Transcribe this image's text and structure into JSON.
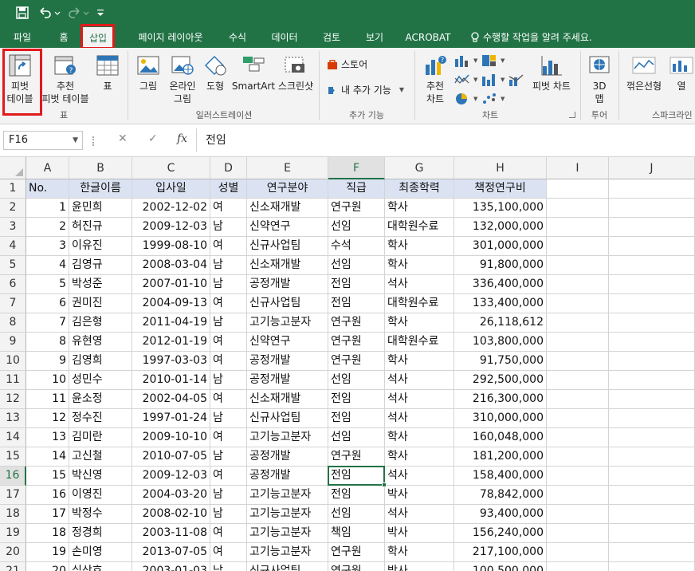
{
  "qat": {
    "save_icon": "save-icon",
    "undo_icon": "undo-icon",
    "redo_icon": "redo-icon",
    "customize_icon": "customize-icon"
  },
  "tabs": [
    "파일",
    "홈",
    "삽입",
    "페이지 레이아웃",
    "수식",
    "데이터",
    "검토",
    "보기",
    "ACROBAT"
  ],
  "tell_me": "수행할 작업을 알려 주세요.",
  "ribbon": {
    "pivot_table": [
      "피벗",
      "테이블"
    ],
    "recommended_pivot": [
      "추천",
      "피벗 테이블"
    ],
    "table": "표",
    "tables_group": "표",
    "picture": "그림",
    "online_picture": [
      "온라인",
      "그림"
    ],
    "shapes": "도형",
    "smartart": "SmartArt",
    "screenshot": "스크린샷",
    "illustrations_group": "일러스트레이션",
    "store": "스토어",
    "my_addins": "내 추가 기능",
    "addins_group": "추가 기능",
    "recommended_charts": [
      "추천",
      "차트"
    ],
    "pivot_chart": "피벗 차트",
    "charts_group": "차트",
    "map3d": [
      "3D",
      "맵"
    ],
    "tours_group": "투어",
    "sparkline_line": "꺾은선형",
    "sparkline_column": "열",
    "sparklines_group": "스파크라인"
  },
  "formula_bar": {
    "name_box": "F16",
    "cancel": "✕",
    "enter": "✓",
    "fx": "fx",
    "content": "전임"
  },
  "columns": [
    "A",
    "B",
    "C",
    "D",
    "E",
    "F",
    "G",
    "H",
    "I",
    "J"
  ],
  "header_row": [
    "No.",
    "한글이름",
    "입사일",
    "성별",
    "연구분야",
    "직급",
    "최종학력",
    "책정연구비"
  ],
  "rows": [
    [
      "1",
      "윤민희",
      "2002-12-02",
      "여",
      "신소재개발",
      "연구원",
      "학사",
      "135,100,000"
    ],
    [
      "2",
      "허진규",
      "2009-12-03",
      "남",
      "신약연구",
      "선임",
      "대학원수료",
      "132,000,000"
    ],
    [
      "3",
      "이유진",
      "1999-08-10",
      "여",
      "신규사업팀",
      "수석",
      "학사",
      "301,000,000"
    ],
    [
      "4",
      "김영규",
      "2008-03-04",
      "남",
      "신소재개발",
      "선임",
      "학사",
      "91,800,000"
    ],
    [
      "5",
      "박성준",
      "2007-01-10",
      "남",
      "공정개발",
      "전임",
      "석사",
      "336,400,000"
    ],
    [
      "6",
      "권미진",
      "2004-09-13",
      "여",
      "신규사업팀",
      "전임",
      "대학원수료",
      "133,400,000"
    ],
    [
      "7",
      "김은형",
      "2011-04-19",
      "남",
      "고기능고분자",
      "연구원",
      "학사",
      "26,118,612"
    ],
    [
      "8",
      "유현영",
      "2012-01-19",
      "여",
      "신약연구",
      "연구원",
      "대학원수료",
      "103,800,000"
    ],
    [
      "9",
      "김영희",
      "1997-03-03",
      "여",
      "공정개발",
      "연구원",
      "학사",
      "91,750,000"
    ],
    [
      "10",
      "성민수",
      "2010-01-14",
      "남",
      "공정개발",
      "선임",
      "석사",
      "292,500,000"
    ],
    [
      "11",
      "윤소정",
      "2002-04-05",
      "여",
      "신소재개발",
      "전임",
      "석사",
      "216,300,000"
    ],
    [
      "12",
      "정수진",
      "1997-01-24",
      "남",
      "신규사업팀",
      "전임",
      "석사",
      "310,000,000"
    ],
    [
      "13",
      "김미란",
      "2009-10-10",
      "여",
      "고기능고분자",
      "선임",
      "학사",
      "160,048,000"
    ],
    [
      "14",
      "고신철",
      "2010-07-05",
      "남",
      "공정개발",
      "연구원",
      "학사",
      "181,200,000"
    ],
    [
      "15",
      "박신영",
      "2009-12-03",
      "여",
      "공정개발",
      "전임",
      "석사",
      "158,400,000"
    ],
    [
      "16",
      "이영진",
      "2004-03-20",
      "남",
      "고기능고분자",
      "전임",
      "박사",
      "78,842,000"
    ],
    [
      "17",
      "박정수",
      "2008-02-10",
      "남",
      "고기능고분자",
      "선임",
      "석사",
      "93,400,000"
    ],
    [
      "18",
      "정경희",
      "2003-11-08",
      "여",
      "고기능고분자",
      "책임",
      "박사",
      "156,240,000"
    ],
    [
      "19",
      "손미영",
      "2013-07-05",
      "여",
      "고기능고분자",
      "연구원",
      "학사",
      "217,100,000"
    ],
    [
      "20",
      "심상호",
      "2003-01-03",
      "남",
      "신규사업팀",
      "연구원",
      "박사",
      "100,500,000"
    ]
  ],
  "colors": {
    "excel_green": "#217346",
    "header_fill": "#dbe3f3",
    "highlight_red": "#e21a1a"
  }
}
